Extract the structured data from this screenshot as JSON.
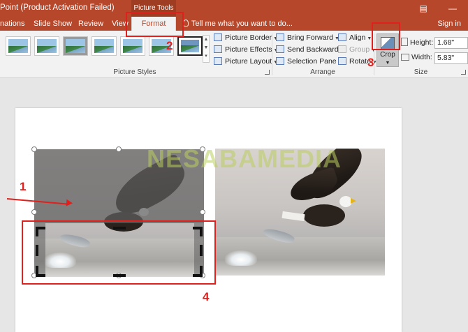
{
  "titlebar": {
    "title": "Point (Product Activation Failed)",
    "context_tab_header": "Picture Tools",
    "restore_icon": "ribbon-display-icon",
    "minimize_icon": "minimize-icon"
  },
  "tabs": {
    "items": [
      "nations",
      "Slide Show",
      "Review",
      "View"
    ],
    "active": "Format",
    "tell_me": "Tell me what you want to do...",
    "sign_in": "Sign in"
  },
  "picture_styles": {
    "group_label": "Picture Styles",
    "thumbnail_count": 7,
    "border": "Picture Border",
    "effects": "Picture Effects",
    "layout": "Picture Layout"
  },
  "arrange": {
    "group_label": "Arrange",
    "bring_forward": "Bring Forward",
    "send_backward": "Send Backward",
    "selection_pane": "Selection Pane",
    "align": "Align",
    "group": "Group",
    "rotate": "Rotate"
  },
  "size": {
    "group_label": "Size",
    "crop_label": "Crop",
    "height_label": "Height:",
    "height_value": "1.68\"",
    "width_label": "Width:",
    "width_value": "5.83\""
  },
  "slide": {
    "watermark": "NESABAMEDIA"
  },
  "callouts": [
    "1",
    "2",
    "3",
    "4"
  ],
  "colors": {
    "accent": "#b7472a",
    "highlight": "#e0201c"
  }
}
